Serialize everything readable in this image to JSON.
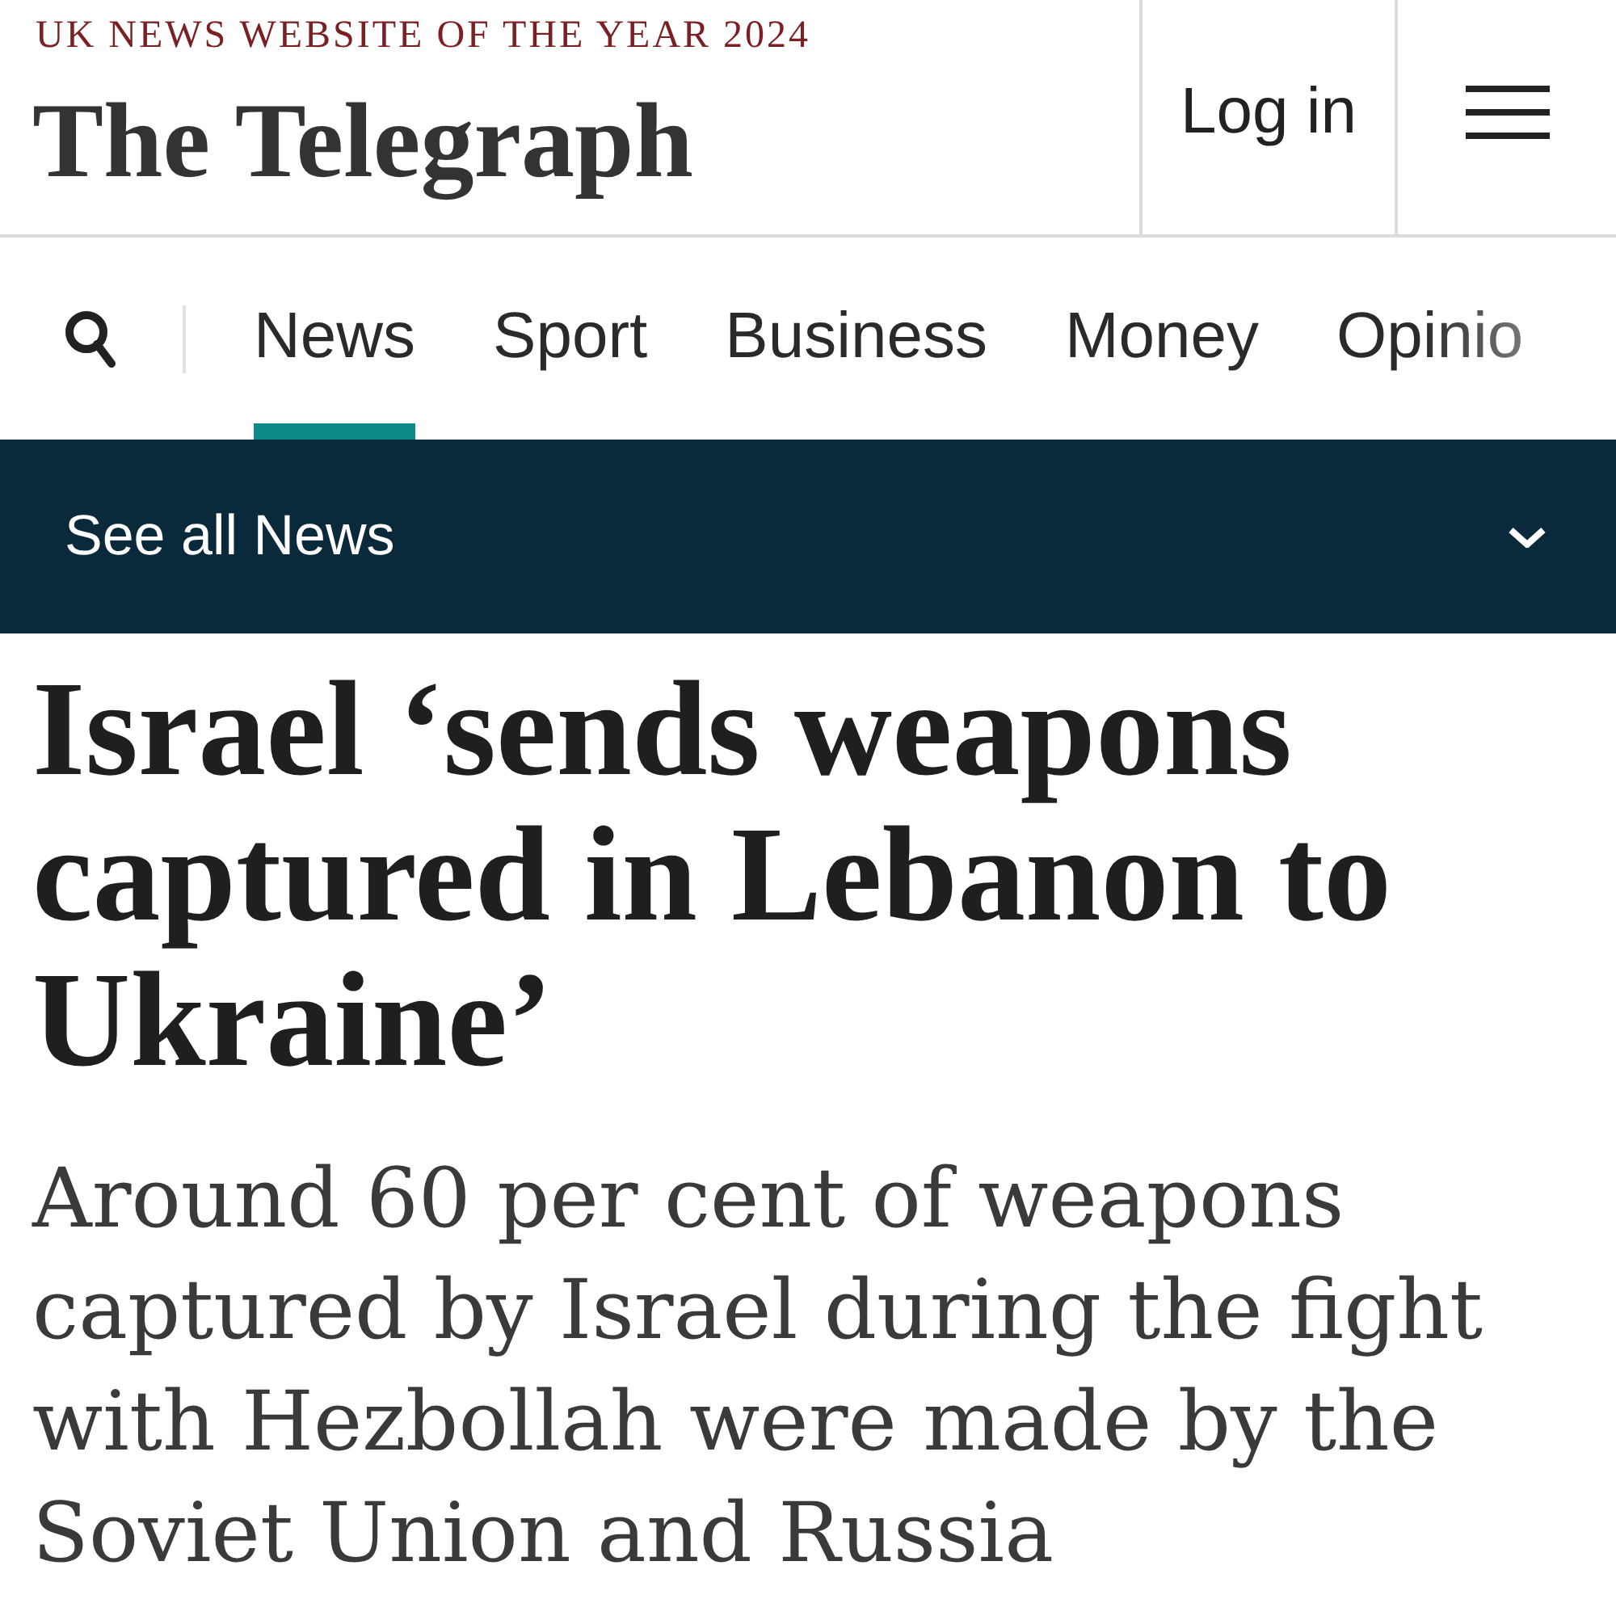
{
  "header": {
    "tagline": "UK NEWS WEBSITE OF THE YEAR 2024",
    "logo": "The Telegraph",
    "login": "Log in"
  },
  "nav": {
    "tabs": [
      {
        "label": "News",
        "selected": true
      },
      {
        "label": "Sport",
        "selected": false
      },
      {
        "label": "Business",
        "selected": false
      },
      {
        "label": "Money",
        "selected": false
      },
      {
        "label": "Opinio",
        "selected": false
      }
    ]
  },
  "section_bar": {
    "label": "See all News",
    "expanded": false
  },
  "article": {
    "headline": "Israel ‘sends weapons captured in Lebanon to Ukraine’",
    "standfirst": "Around 60 per cent of weapons captured by Israel during the fight with Hezbollah were made by the Soviet Union and Russia"
  }
}
